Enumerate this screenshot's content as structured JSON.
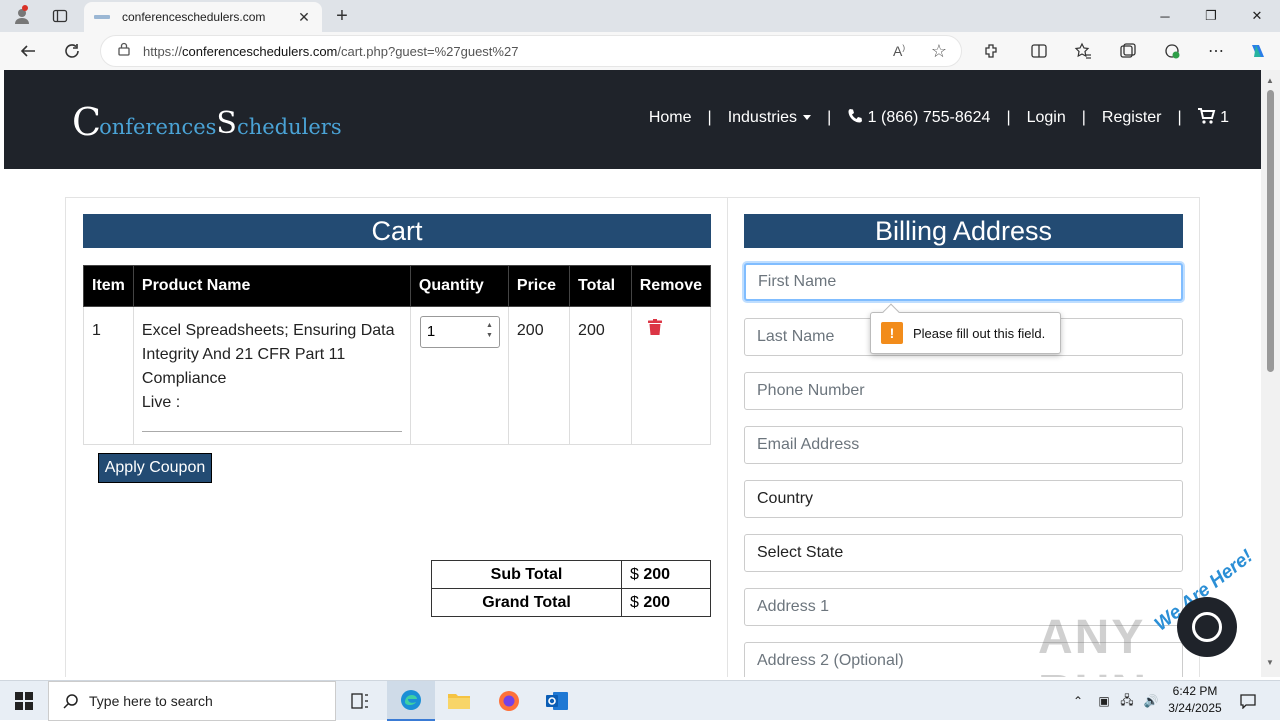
{
  "browser": {
    "tab_title": "conferenceschedulers.com",
    "url_prefix": "https://",
    "url_domain": "conferenceschedulers.com",
    "url_path": "/cart.php?guest=%27guest%27"
  },
  "site": {
    "logo_c": "C",
    "logo_part1": "onferences",
    "logo_s": "S",
    "logo_part2": "chedulers",
    "nav": {
      "home": "Home",
      "industries": "Industries",
      "phone": "1 (866) 755-8624",
      "login": "Login",
      "register": "Register",
      "cart_count": "1",
      "separator": "|"
    }
  },
  "cart": {
    "title": "Cart",
    "headers": [
      "Item",
      "Product Name",
      "Quantity",
      "Price",
      "Total",
      "Remove"
    ],
    "rows": [
      {
        "item": "1",
        "product": "Excel Spreadsheets; Ensuring Data Integrity And 21 CFR Part 11 Compliance",
        "live": "Live :",
        "quantity": "1",
        "price": "200",
        "total": "200"
      }
    ],
    "apply_coupon": "Apply Coupon",
    "sub_total_label": "Sub Total",
    "sub_total_value": "200",
    "grand_total_label": "Grand Total",
    "grand_total_value": "200",
    "currency": "$"
  },
  "billing": {
    "title": "Billing Address",
    "first_name": "First Name",
    "last_name": "Last Name",
    "phone": "Phone Number",
    "email": "Email Address",
    "country": "Country",
    "state": "Select State",
    "address1": "Address 1",
    "address2": "Address 2 (Optional)",
    "validation_message": "Please fill out this field."
  },
  "chat": {
    "we_are_here": "We Are Here!"
  },
  "watermark": "ANY RUN",
  "taskbar": {
    "search_placeholder": "Type here to search",
    "time": "6:42 PM",
    "date": "3/24/2025"
  },
  "colors": {
    "header_bg": "#1f232a",
    "section_title_bg": "#234b73",
    "logo_accent": "#4aa3d6",
    "trash": "#dc3545"
  }
}
